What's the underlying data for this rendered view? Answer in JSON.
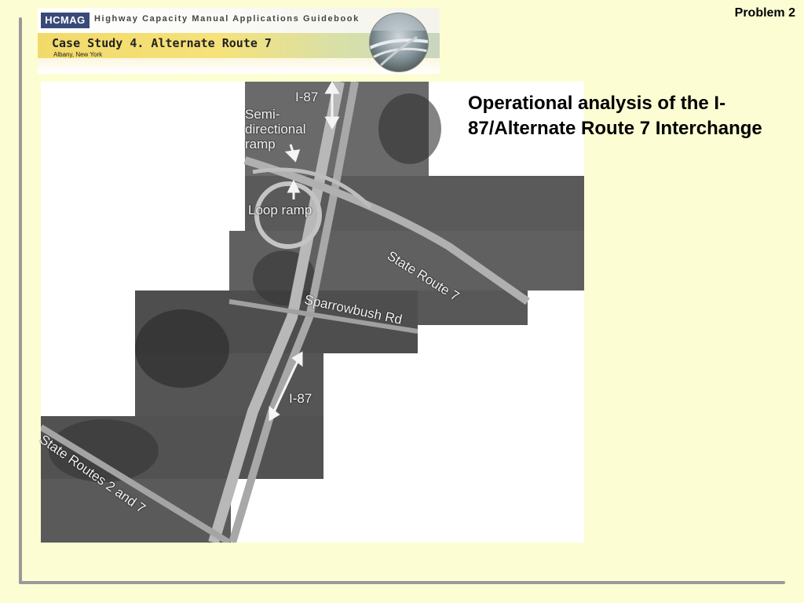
{
  "problem_label": "Problem 2",
  "banner": {
    "logo_text": "HCMAG",
    "guidebook_title": "Highway Capacity Manual Applications Guidebook",
    "case_title": "Case Study 4. Alternate Route 7",
    "location": "Albany, New York"
  },
  "slide_title": "Operational analysis of the I-87/Alternate Route 7 Interchange",
  "map_labels": {
    "i87_top": "I-87",
    "semi_directional_ramp": "Semi-\ndirectional\nramp",
    "loop_ramp": "Loop ramp",
    "state_route_7": "State Route 7",
    "sparrowbush_rd": "Sparrowbush Rd",
    "i87_bottom": "I-87",
    "state_routes_2_and_7": "State Routes 2 and 7"
  }
}
